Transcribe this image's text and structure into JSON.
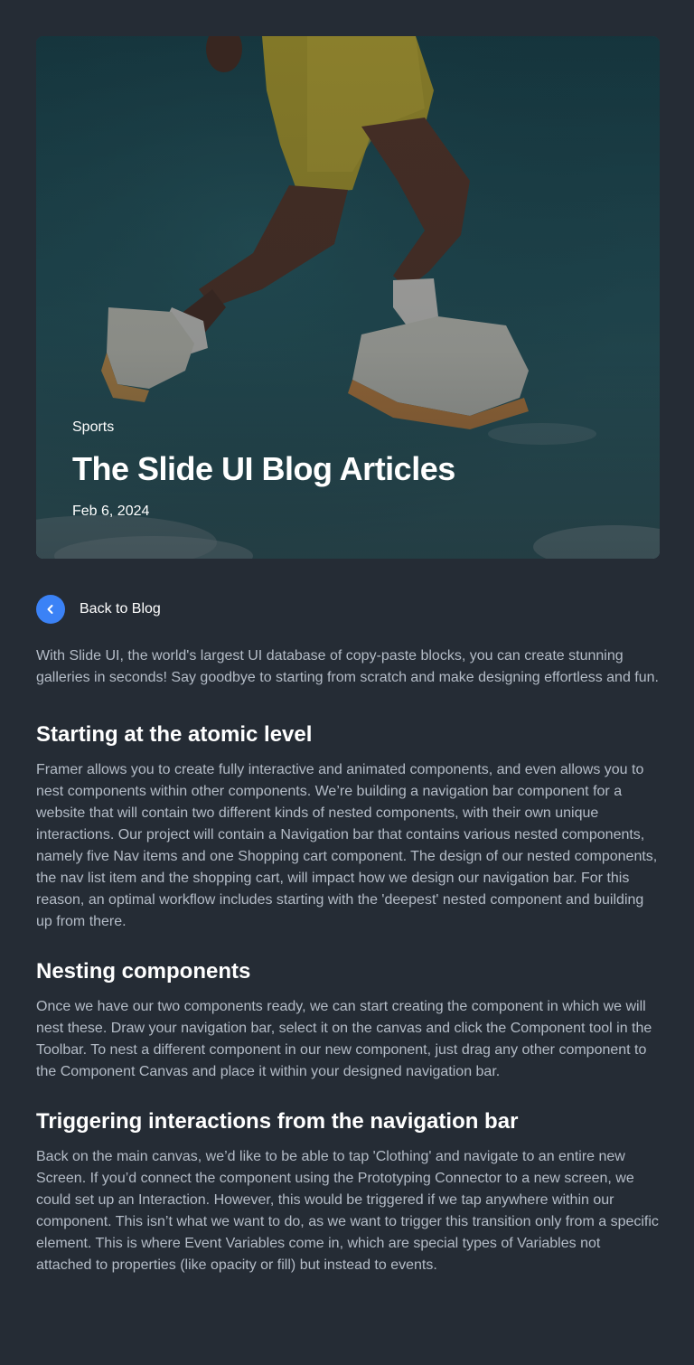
{
  "hero": {
    "category": "Sports",
    "title": "The Slide UI Blog Articles",
    "date": "Feb 6, 2024"
  },
  "nav": {
    "back_label": "Back to Blog",
    "back_icon": "chevron-left-icon"
  },
  "article": {
    "intro": "With Slide UI, the world's largest UI database of copy-paste blocks, you can create stunning galleries in seconds! Say goodbye to starting from scratch and make designing effortless and fun.",
    "sections": [
      {
        "heading": "Starting at the atomic level",
        "body": "Framer allows you to create fully interactive and animated components, and even allows you to nest components within other components. We’re building a navigation bar component for a website that will contain two different kinds of nested components, with their own unique interactions. Our project will contain a Navigation bar that contains various nested components, namely five Nav items and one Shopping cart component. The design of our nested components, the nav list item and the shopping cart, will impact how we design our navigation bar. For this reason, an optimal workflow includes starting with the 'deepest' nested component and building up from there."
      },
      {
        "heading": "Nesting components",
        "body": " Once we have our two components ready, we can start creating the component in which we will nest these. Draw your navigation bar, select it on the canvas and click the Component tool in the Toolbar. To nest a different component in our new component, just drag any other component to the Component Canvas and place it within your designed navigation bar."
      },
      {
        "heading": "Triggering interactions from the navigation bar",
        "body": " Back on the main canvas, we’d like to be able to tap 'Clothing' and navigate to an entire new Screen. If you’d connect the component using the Prototyping Connector to a new screen, we could set up an Interaction. However, this would be triggered if we tap anywhere within our component. This isn’t what we want to do, as we want to trigger this transition only from a specific element. This is where Event Variables come in, which are special types of Variables not attached to properties (like opacity or fill) but instead to events."
      }
    ]
  },
  "colors": {
    "background": "#252c35",
    "accent": "#3b82f6",
    "body_text": "#b4bcc7",
    "heading_text": "#ffffff"
  }
}
